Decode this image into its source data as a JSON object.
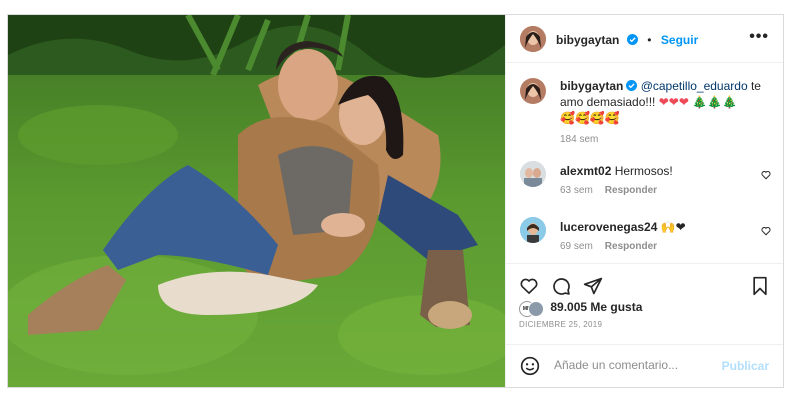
{
  "post": {
    "author": "bibygaytan",
    "follow_label": "Seguir",
    "more_label": "•••",
    "caption": {
      "mention": "@capetillo_eduardo",
      "text": "te amo demasiado!!!",
      "hearts": "❤❤❤",
      "trees": "🎄🎄🎄",
      "emojis": "🥰🥰🥰🥰",
      "time": "184 sem"
    },
    "comments": [
      {
        "user": "alexmt02",
        "text": "Hermosos!",
        "time": "63 sem",
        "reply": "Responder"
      },
      {
        "user": "lucerovenegas24",
        "text": "🙌❤",
        "time": "69 sem",
        "reply": "Responder"
      }
    ],
    "likes_count": "89.005",
    "likes_label": "Me gusta",
    "date": "DICIEMBRE 25, 2019",
    "add_comment_placeholder": "Añade un comentario...",
    "publish_label": "Publicar"
  },
  "colors": {
    "accent": "#0095f6",
    "heart": "#ed4956",
    "muted": "#8e8e8e",
    "publish_disabled": "#b2dffc"
  },
  "icons": [
    "verified-badge-icon",
    "more-options-icon",
    "like-heart-icon",
    "comment-icon",
    "share-icon",
    "save-bookmark-icon",
    "emoji-icon",
    "comment-heart-icon"
  ]
}
